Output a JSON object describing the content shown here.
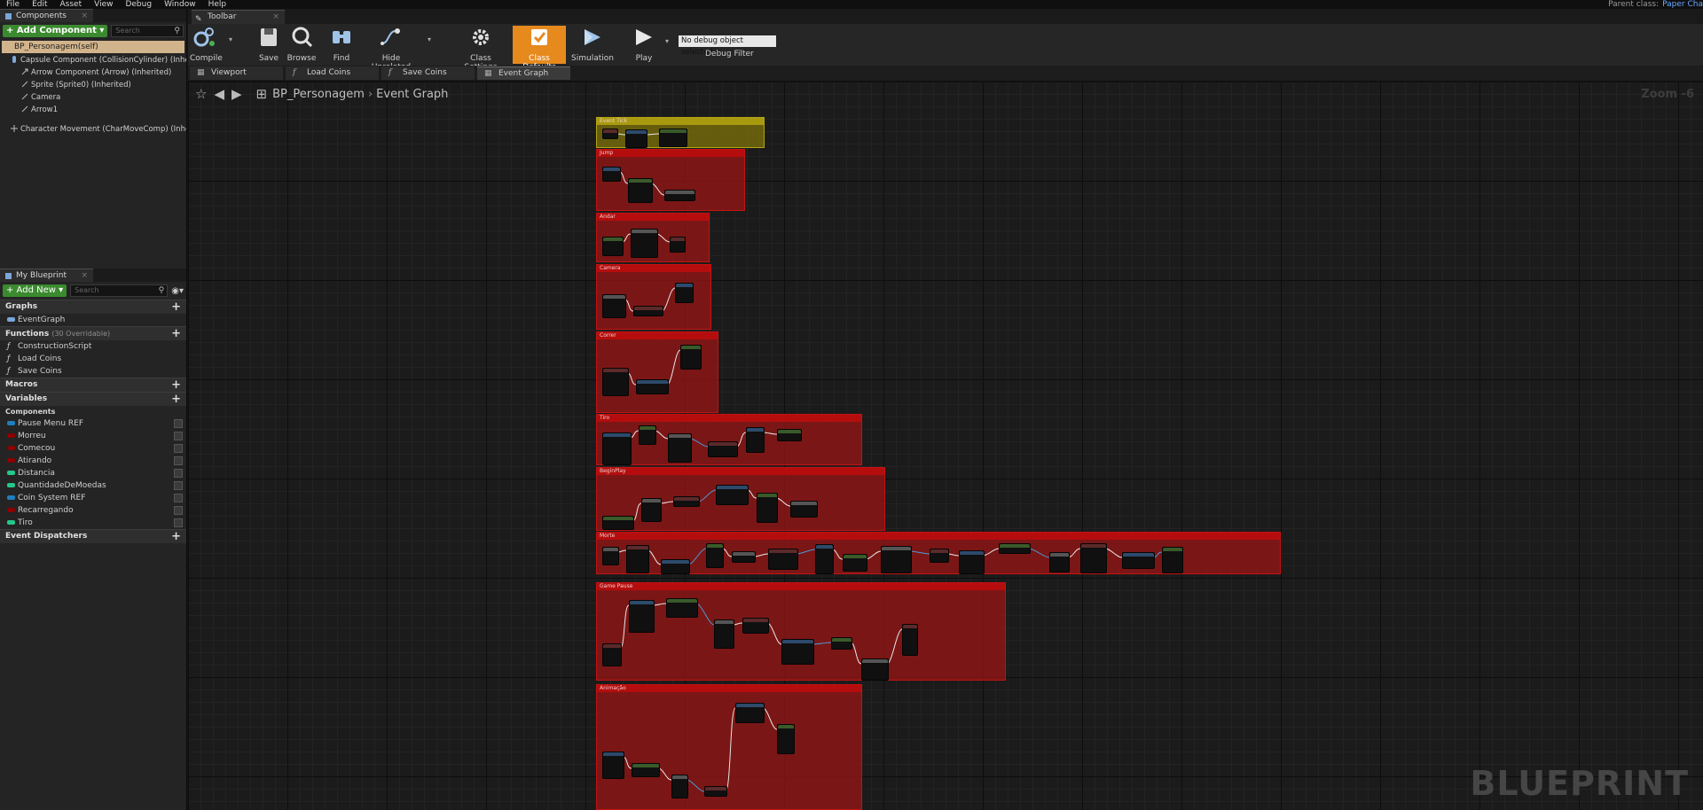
{
  "menu": [
    "File",
    "Edit",
    "Asset",
    "View",
    "Debug",
    "Window",
    "Help"
  ],
  "parent_class": {
    "label": "Parent class:",
    "value": "Paper Cha"
  },
  "components_panel": {
    "tab": "Components",
    "add_button": "+ Add Component ▾",
    "search_placeholder": "Search",
    "self_item": "BP_Personagem(self)",
    "tree": [
      "Capsule Component (CollisionCylinder) (Inherit",
      "Arrow Component (Arrow) (Inherited)",
      "Sprite (Sprite0) (Inherited)",
      "Camera",
      "Arrow1",
      "Character Movement (CharMoveComp) (Inherit"
    ]
  },
  "my_blueprint": {
    "tab": "My Blueprint",
    "add_new": "+ Add New ▾",
    "search_placeholder": "Search",
    "graphs_label": "Graphs",
    "graphs": [
      "EventGraph"
    ],
    "functions_label": "Functions",
    "functions_overridable": "(30 Overridable)",
    "functions": [
      "ConstructionScript",
      "Load Coins",
      "Save Coins"
    ],
    "macros_label": "Macros",
    "variables_label": "Variables",
    "components_label": "Components",
    "variables": [
      {
        "name": "Pause Menu REF",
        "color": "#1e7fbf"
      },
      {
        "name": "Morreu",
        "color": "#8c0000"
      },
      {
        "name": "Comecou",
        "color": "#8c0000"
      },
      {
        "name": "Atirando",
        "color": "#8c0000"
      },
      {
        "name": "Distancia",
        "color": "#23c88a"
      },
      {
        "name": "QuantidadeDeMoedas",
        "color": "#23c88a"
      },
      {
        "name": "Coin System REF",
        "color": "#1e7fbf"
      },
      {
        "name": "Recarregando",
        "color": "#8c0000"
      },
      {
        "name": "Tiro",
        "color": "#23c88a"
      }
    ],
    "event_dispatchers_label": "Event Dispatchers"
  },
  "toolbar": {
    "tab": "Toolbar",
    "buttons": [
      "Compile",
      "Save",
      "Browse",
      "Find",
      "Hide Unrelated",
      "Class Settings",
      "Class Defaults",
      "Simulation",
      "Play"
    ],
    "debug_select": "No debug object selected ▾",
    "debug_filter_label": "Debug Filter"
  },
  "doc_tabs": [
    "Viewport",
    "Load Coins",
    "Save Coins",
    "Event Graph"
  ],
  "graph": {
    "breadcrumb_blueprint": "BP_Personagem",
    "breadcrumb_graph": "Event Graph",
    "zoom": "Zoom -6",
    "watermark": "BLUEPRINT",
    "comment_titles": [
      "Event Tick",
      "Jump",
      "Andar",
      "Camera",
      "Correr",
      "Tiro",
      "BeginPlay",
      "Morte",
      "Game Pause",
      "Animação"
    ]
  },
  "colors": {
    "accent_orange": "#e68a1e",
    "add_green": "#3b8a2f",
    "comment_red": "#b50d0d",
    "comment_yellow": "#a89a0f"
  }
}
